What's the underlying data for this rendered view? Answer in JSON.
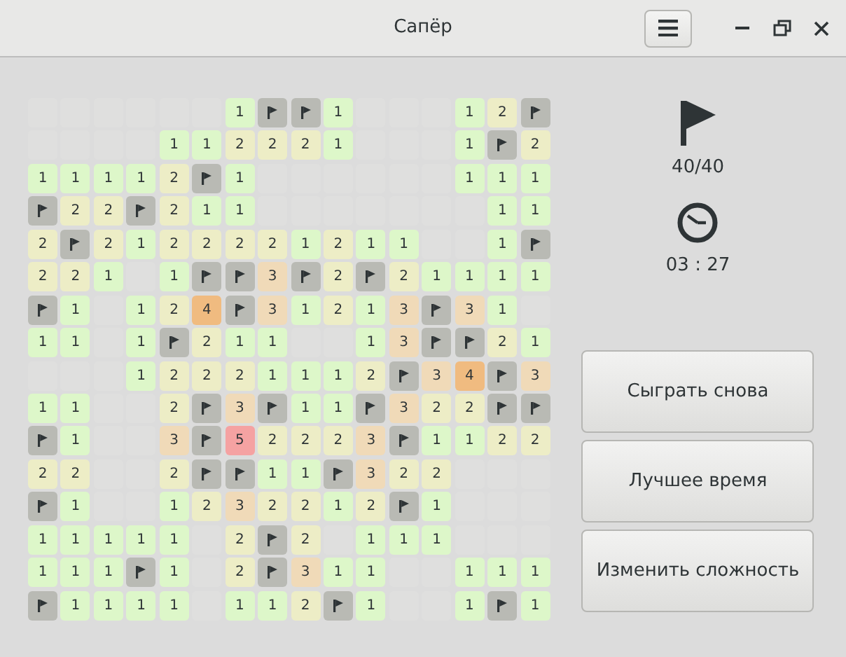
{
  "window": {
    "title": "Сапёр"
  },
  "field": {
    "rows": [
      [
        {
          "kind": "empty"
        },
        {
          "kind": "empty"
        },
        {
          "kind": "empty"
        },
        {
          "kind": "empty"
        },
        {
          "kind": "empty"
        },
        {
          "kind": "empty"
        },
        {
          "kind": "number",
          "value": "1",
          "color": "#ddf7c9"
        },
        {
          "kind": "flag"
        },
        {
          "kind": "flag"
        },
        {
          "kind": "number",
          "value": "1",
          "color": "#ddf7c9"
        },
        {
          "kind": "empty"
        },
        {
          "kind": "empty"
        },
        {
          "kind": "empty"
        },
        {
          "kind": "number",
          "value": "1",
          "color": "#ddf7c9"
        },
        {
          "kind": "number",
          "value": "2",
          "color": "#ededc6"
        },
        {
          "kind": "flag"
        }
      ],
      [
        {
          "kind": "empty"
        },
        {
          "kind": "empty"
        },
        {
          "kind": "empty"
        },
        {
          "kind": "empty"
        },
        {
          "kind": "number",
          "value": "1",
          "color": "#ddf7c9"
        },
        {
          "kind": "number",
          "value": "1",
          "color": "#ddf7c9"
        },
        {
          "kind": "number",
          "value": "2",
          "color": "#ededc6"
        },
        {
          "kind": "number",
          "value": "2",
          "color": "#ededc6"
        },
        {
          "kind": "number",
          "value": "2",
          "color": "#ededc6"
        },
        {
          "kind": "number",
          "value": "1",
          "color": "#ddf7c9"
        },
        {
          "kind": "empty"
        },
        {
          "kind": "empty"
        },
        {
          "kind": "empty"
        },
        {
          "kind": "number",
          "value": "1",
          "color": "#ddf7c9"
        },
        {
          "kind": "flag"
        },
        {
          "kind": "number",
          "value": "2",
          "color": "#ededc6"
        }
      ],
      [
        {
          "kind": "number",
          "value": "1",
          "color": "#ddf7c9"
        },
        {
          "kind": "number",
          "value": "1",
          "color": "#ddf7c9"
        },
        {
          "kind": "number",
          "value": "1",
          "color": "#ddf7c9"
        },
        {
          "kind": "number",
          "value": "1",
          "color": "#ddf7c9"
        },
        {
          "kind": "number",
          "value": "2",
          "color": "#ededc6"
        },
        {
          "kind": "flag"
        },
        {
          "kind": "number",
          "value": "1",
          "color": "#ddf7c9"
        },
        {
          "kind": "empty"
        },
        {
          "kind": "empty"
        },
        {
          "kind": "empty"
        },
        {
          "kind": "empty"
        },
        {
          "kind": "empty"
        },
        {
          "kind": "empty"
        },
        {
          "kind": "number",
          "value": "1",
          "color": "#ddf7c9"
        },
        {
          "kind": "number",
          "value": "1",
          "color": "#ddf7c9"
        },
        {
          "kind": "number",
          "value": "1",
          "color": "#ddf7c9"
        }
      ],
      [
        {
          "kind": "flag"
        },
        {
          "kind": "number",
          "value": "2",
          "color": "#ededc6"
        },
        {
          "kind": "number",
          "value": "2",
          "color": "#ededc6"
        },
        {
          "kind": "flag"
        },
        {
          "kind": "number",
          "value": "2",
          "color": "#ededc6"
        },
        {
          "kind": "number",
          "value": "1",
          "color": "#ddf7c9"
        },
        {
          "kind": "number",
          "value": "1",
          "color": "#ddf7c9"
        },
        {
          "kind": "empty"
        },
        {
          "kind": "empty"
        },
        {
          "kind": "empty"
        },
        {
          "kind": "empty"
        },
        {
          "kind": "empty"
        },
        {
          "kind": "empty"
        },
        {
          "kind": "empty"
        },
        {
          "kind": "number",
          "value": "1",
          "color": "#ddf7c9"
        },
        {
          "kind": "number",
          "value": "1",
          "color": "#ddf7c9"
        }
      ],
      [
        {
          "kind": "number",
          "value": "2",
          "color": "#ededc6"
        },
        {
          "kind": "flag"
        },
        {
          "kind": "number",
          "value": "2",
          "color": "#ededc6"
        },
        {
          "kind": "number",
          "value": "1",
          "color": "#ddf7c9"
        },
        {
          "kind": "number",
          "value": "2",
          "color": "#ededc6"
        },
        {
          "kind": "number",
          "value": "2",
          "color": "#ededc6"
        },
        {
          "kind": "number",
          "value": "2",
          "color": "#ededc6"
        },
        {
          "kind": "number",
          "value": "2",
          "color": "#ededc6"
        },
        {
          "kind": "number",
          "value": "1",
          "color": "#ddf7c9"
        },
        {
          "kind": "number",
          "value": "2",
          "color": "#ededc6"
        },
        {
          "kind": "number",
          "value": "1",
          "color": "#ddf7c9"
        },
        {
          "kind": "number",
          "value": "1",
          "color": "#ddf7c9"
        },
        {
          "kind": "empty"
        },
        {
          "kind": "empty"
        },
        {
          "kind": "number",
          "value": "1",
          "color": "#ddf7c9"
        },
        {
          "kind": "flag"
        }
      ],
      [
        {
          "kind": "number",
          "value": "2",
          "color": "#ededc6"
        },
        {
          "kind": "number",
          "value": "2",
          "color": "#ededc6"
        },
        {
          "kind": "number",
          "value": "1",
          "color": "#ddf7c9"
        },
        {
          "kind": "empty"
        },
        {
          "kind": "number",
          "value": "1",
          "color": "#ddf7c9"
        },
        {
          "kind": "flag"
        },
        {
          "kind": "flag"
        },
        {
          "kind": "number",
          "value": "3",
          "color": "#f0dab8"
        },
        {
          "kind": "flag"
        },
        {
          "kind": "number",
          "value": "2",
          "color": "#ededc6"
        },
        {
          "kind": "flag"
        },
        {
          "kind": "number",
          "value": "2",
          "color": "#ededc6"
        },
        {
          "kind": "number",
          "value": "1",
          "color": "#ddf7c9"
        },
        {
          "kind": "number",
          "value": "1",
          "color": "#ddf7c9"
        },
        {
          "kind": "number",
          "value": "1",
          "color": "#ddf7c9"
        },
        {
          "kind": "number",
          "value": "1",
          "color": "#ddf7c9"
        }
      ],
      [
        {
          "kind": "flag"
        },
        {
          "kind": "number",
          "value": "1",
          "color": "#ddf7c9"
        },
        {
          "kind": "empty"
        },
        {
          "kind": "number",
          "value": "1",
          "color": "#ddf7c9"
        },
        {
          "kind": "number",
          "value": "2",
          "color": "#ededc6"
        },
        {
          "kind": "number",
          "value": "4",
          "color": "#f0bb80"
        },
        {
          "kind": "flag"
        },
        {
          "kind": "number",
          "value": "3",
          "color": "#f0dab8"
        },
        {
          "kind": "number",
          "value": "1",
          "color": "#ddf7c9"
        },
        {
          "kind": "number",
          "value": "2",
          "color": "#ededc6"
        },
        {
          "kind": "number",
          "value": "1",
          "color": "#ddf7c9"
        },
        {
          "kind": "number",
          "value": "3",
          "color": "#f0dab8"
        },
        {
          "kind": "flag"
        },
        {
          "kind": "number",
          "value": "3",
          "color": "#f0dab8"
        },
        {
          "kind": "number",
          "value": "1",
          "color": "#ddf7c9"
        },
        {
          "kind": "empty"
        }
      ],
      [
        {
          "kind": "number",
          "value": "1",
          "color": "#ddf7c9"
        },
        {
          "kind": "number",
          "value": "1",
          "color": "#ddf7c9"
        },
        {
          "kind": "empty"
        },
        {
          "kind": "number",
          "value": "1",
          "color": "#ddf7c9"
        },
        {
          "kind": "flag"
        },
        {
          "kind": "number",
          "value": "2",
          "color": "#ededc6"
        },
        {
          "kind": "number",
          "value": "1",
          "color": "#ddf7c9"
        },
        {
          "kind": "number",
          "value": "1",
          "color": "#ddf7c9"
        },
        {
          "kind": "empty"
        },
        {
          "kind": "empty"
        },
        {
          "kind": "number",
          "value": "1",
          "color": "#ddf7c9"
        },
        {
          "kind": "number",
          "value": "3",
          "color": "#f0dab8"
        },
        {
          "kind": "flag"
        },
        {
          "kind": "flag"
        },
        {
          "kind": "number",
          "value": "2",
          "color": "#ededc6"
        },
        {
          "kind": "number",
          "value": "1",
          "color": "#ddf7c9"
        }
      ],
      [
        {
          "kind": "empty"
        },
        {
          "kind": "empty"
        },
        {
          "kind": "empty"
        },
        {
          "kind": "number",
          "value": "1",
          "color": "#ddf7c9"
        },
        {
          "kind": "number",
          "value": "2",
          "color": "#ededc6"
        },
        {
          "kind": "number",
          "value": "2",
          "color": "#ededc6"
        },
        {
          "kind": "number",
          "value": "2",
          "color": "#ededc6"
        },
        {
          "kind": "number",
          "value": "1",
          "color": "#ddf7c9"
        },
        {
          "kind": "number",
          "value": "1",
          "color": "#ddf7c9"
        },
        {
          "kind": "number",
          "value": "1",
          "color": "#ddf7c9"
        },
        {
          "kind": "number",
          "value": "2",
          "color": "#ededc6"
        },
        {
          "kind": "flag"
        },
        {
          "kind": "number",
          "value": "3",
          "color": "#f0dab8"
        },
        {
          "kind": "number",
          "value": "4",
          "color": "#f0bb80"
        },
        {
          "kind": "flag"
        },
        {
          "kind": "number",
          "value": "3",
          "color": "#f0dab8"
        }
      ],
      [
        {
          "kind": "number",
          "value": "1",
          "color": "#ddf7c9"
        },
        {
          "kind": "number",
          "value": "1",
          "color": "#ddf7c9"
        },
        {
          "kind": "empty"
        },
        {
          "kind": "empty"
        },
        {
          "kind": "number",
          "value": "2",
          "color": "#ededc6"
        },
        {
          "kind": "flag"
        },
        {
          "kind": "number",
          "value": "3",
          "color": "#f0dab8"
        },
        {
          "kind": "flag"
        },
        {
          "kind": "number",
          "value": "1",
          "color": "#ddf7c9"
        },
        {
          "kind": "number",
          "value": "1",
          "color": "#ddf7c9"
        },
        {
          "kind": "flag"
        },
        {
          "kind": "number",
          "value": "3",
          "color": "#f0dab8"
        },
        {
          "kind": "number",
          "value": "2",
          "color": "#ededc6"
        },
        {
          "kind": "number",
          "value": "2",
          "color": "#ededc6"
        },
        {
          "kind": "flag"
        },
        {
          "kind": "flag"
        }
      ],
      [
        {
          "kind": "flag"
        },
        {
          "kind": "number",
          "value": "1",
          "color": "#ddf7c9"
        },
        {
          "kind": "empty"
        },
        {
          "kind": "empty"
        },
        {
          "kind": "number",
          "value": "3",
          "color": "#f0dab8"
        },
        {
          "kind": "flag"
        },
        {
          "kind": "number",
          "value": "5",
          "color": "#f5a2a2"
        },
        {
          "kind": "number",
          "value": "2",
          "color": "#ededc6"
        },
        {
          "kind": "number",
          "value": "2",
          "color": "#ededc6"
        },
        {
          "kind": "number",
          "value": "2",
          "color": "#ededc6"
        },
        {
          "kind": "number",
          "value": "3",
          "color": "#f0dab8"
        },
        {
          "kind": "flag"
        },
        {
          "kind": "number",
          "value": "1",
          "color": "#ddf7c9"
        },
        {
          "kind": "number",
          "value": "1",
          "color": "#ddf7c9"
        },
        {
          "kind": "number",
          "value": "2",
          "color": "#ededc6"
        },
        {
          "kind": "number",
          "value": "2",
          "color": "#ededc6"
        }
      ],
      [
        {
          "kind": "number",
          "value": "2",
          "color": "#ededc6"
        },
        {
          "kind": "number",
          "value": "2",
          "color": "#ededc6"
        },
        {
          "kind": "empty"
        },
        {
          "kind": "empty"
        },
        {
          "kind": "number",
          "value": "2",
          "color": "#ededc6"
        },
        {
          "kind": "flag"
        },
        {
          "kind": "flag"
        },
        {
          "kind": "number",
          "value": "1",
          "color": "#ddf7c9"
        },
        {
          "kind": "number",
          "value": "1",
          "color": "#ddf7c9"
        },
        {
          "kind": "flag"
        },
        {
          "kind": "number",
          "value": "3",
          "color": "#f0dab8"
        },
        {
          "kind": "number",
          "value": "2",
          "color": "#ededc6"
        },
        {
          "kind": "number",
          "value": "2",
          "color": "#ededc6"
        },
        {
          "kind": "empty"
        },
        {
          "kind": "empty"
        },
        {
          "kind": "empty"
        }
      ],
      [
        {
          "kind": "flag"
        },
        {
          "kind": "number",
          "value": "1",
          "color": "#ddf7c9"
        },
        {
          "kind": "empty"
        },
        {
          "kind": "empty"
        },
        {
          "kind": "number",
          "value": "1",
          "color": "#ddf7c9"
        },
        {
          "kind": "number",
          "value": "2",
          "color": "#ededc6"
        },
        {
          "kind": "number",
          "value": "3",
          "color": "#f0dab8"
        },
        {
          "kind": "number",
          "value": "2",
          "color": "#ededc6"
        },
        {
          "kind": "number",
          "value": "2",
          "color": "#ededc6"
        },
        {
          "kind": "number",
          "value": "1",
          "color": "#ddf7c9"
        },
        {
          "kind": "number",
          "value": "2",
          "color": "#ededc6"
        },
        {
          "kind": "flag"
        },
        {
          "kind": "number",
          "value": "1",
          "color": "#ddf7c9"
        },
        {
          "kind": "empty"
        },
        {
          "kind": "empty"
        },
        {
          "kind": "empty"
        }
      ],
      [
        {
          "kind": "number",
          "value": "1",
          "color": "#ddf7c9"
        },
        {
          "kind": "number",
          "value": "1",
          "color": "#ddf7c9"
        },
        {
          "kind": "number",
          "value": "1",
          "color": "#ddf7c9"
        },
        {
          "kind": "number",
          "value": "1",
          "color": "#ddf7c9"
        },
        {
          "kind": "number",
          "value": "1",
          "color": "#ddf7c9"
        },
        {
          "kind": "empty"
        },
        {
          "kind": "number",
          "value": "2",
          "color": "#ededc6"
        },
        {
          "kind": "flag"
        },
        {
          "kind": "number",
          "value": "2",
          "color": "#ededc6"
        },
        {
          "kind": "empty"
        },
        {
          "kind": "number",
          "value": "1",
          "color": "#ddf7c9"
        },
        {
          "kind": "number",
          "value": "1",
          "color": "#ddf7c9"
        },
        {
          "kind": "number",
          "value": "1",
          "color": "#ddf7c9"
        },
        {
          "kind": "empty"
        },
        {
          "kind": "empty"
        },
        {
          "kind": "empty"
        }
      ],
      [
        {
          "kind": "number",
          "value": "1",
          "color": "#ddf7c9"
        },
        {
          "kind": "number",
          "value": "1",
          "color": "#ddf7c9"
        },
        {
          "kind": "number",
          "value": "1",
          "color": "#ddf7c9"
        },
        {
          "kind": "flag"
        },
        {
          "kind": "number",
          "value": "1",
          "color": "#ddf7c9"
        },
        {
          "kind": "empty"
        },
        {
          "kind": "number",
          "value": "2",
          "color": "#ededc6"
        },
        {
          "kind": "flag"
        },
        {
          "kind": "number",
          "value": "3",
          "color": "#f0dab8"
        },
        {
          "kind": "number",
          "value": "1",
          "color": "#ddf7c9"
        },
        {
          "kind": "number",
          "value": "1",
          "color": "#ddf7c9"
        },
        {
          "kind": "empty"
        },
        {
          "kind": "empty"
        },
        {
          "kind": "number",
          "value": "1",
          "color": "#ddf7c9"
        },
        {
          "kind": "number",
          "value": "1",
          "color": "#ddf7c9"
        },
        {
          "kind": "number",
          "value": "1",
          "color": "#ddf7c9"
        }
      ],
      [
        {
          "kind": "flag"
        },
        {
          "kind": "number",
          "value": "1",
          "color": "#ddf7c9"
        },
        {
          "kind": "number",
          "value": "1",
          "color": "#ddf7c9"
        },
        {
          "kind": "number",
          "value": "1",
          "color": "#ddf7c9"
        },
        {
          "kind": "number",
          "value": "1",
          "color": "#ddf7c9"
        },
        {
          "kind": "empty"
        },
        {
          "kind": "number",
          "value": "1",
          "color": "#ddf7c9"
        },
        {
          "kind": "number",
          "value": "1",
          "color": "#ddf7c9"
        },
        {
          "kind": "number",
          "value": "2",
          "color": "#ededc6"
        },
        {
          "kind": "flag"
        },
        {
          "kind": "number",
          "value": "1",
          "color": "#ddf7c9"
        },
        {
          "kind": "empty"
        },
        {
          "kind": "empty"
        },
        {
          "kind": "number",
          "value": "1",
          "color": "#ddf7c9"
        },
        {
          "kind": "flag"
        },
        {
          "kind": "number",
          "value": "1",
          "color": "#ddf7c9"
        }
      ]
    ]
  },
  "status": {
    "flags": "40/40",
    "time": "03 : 27"
  },
  "buttons": [
    "Сыграть снова",
    "Лучшее время",
    "Изменить сложность"
  ]
}
